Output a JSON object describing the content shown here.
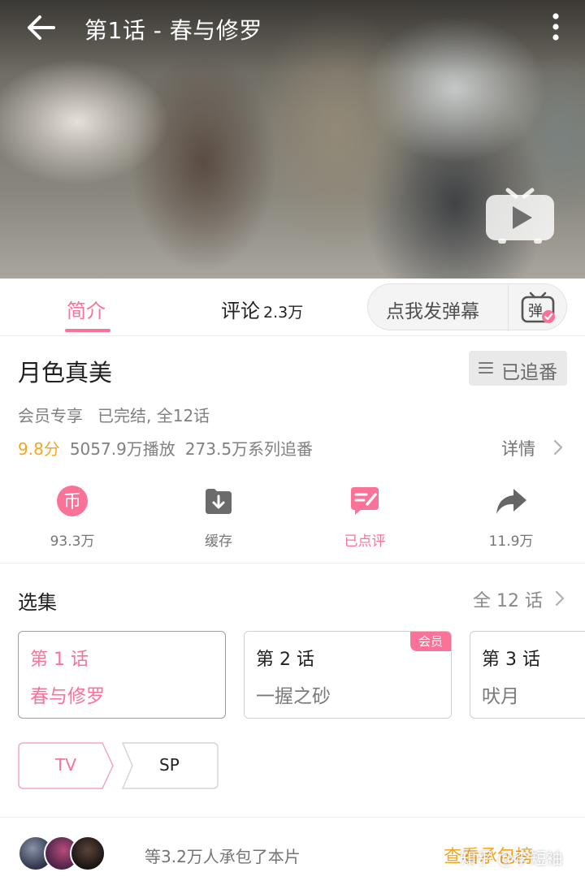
{
  "header": {
    "title": "第1话 - 春与修罗"
  },
  "tabs": {
    "intro": "简介",
    "comment": "评论",
    "comment_count": "2.3万",
    "danmaku_placeholder": "点我发弹幕",
    "danmaku_icon_char": "弹"
  },
  "info": {
    "name": "月色真美",
    "follow_label": "已追番",
    "vip_only": "会员专享",
    "status": "已完结, 全12话",
    "score": "9.8分",
    "plays": "5057.9万播放",
    "series_follows": "273.5万系列追番",
    "detail": "详情"
  },
  "actions": {
    "coin_count": "93.3万",
    "cache": "缓存",
    "reviewed": "已点评",
    "share_count": "11.9万",
    "coin_glyph": "币"
  },
  "episodes": {
    "title": "选集",
    "all": "全 12 话",
    "items": [
      {
        "no": "第 1 话",
        "name": "春与修罗",
        "active": true
      },
      {
        "no": "第 2 话",
        "name": "一握之砂",
        "badge": "会员"
      },
      {
        "no": "第 3 话",
        "name": "吠月"
      }
    ]
  },
  "seasons": [
    "TV",
    "SP"
  ],
  "sponsor": {
    "text": "等3.2万人承包了本片",
    "link": "查看承包榜",
    "watermark": "知乎 @李短袖"
  },
  "colors": {
    "accent": "#fb7299",
    "gold": "#f5a623"
  }
}
